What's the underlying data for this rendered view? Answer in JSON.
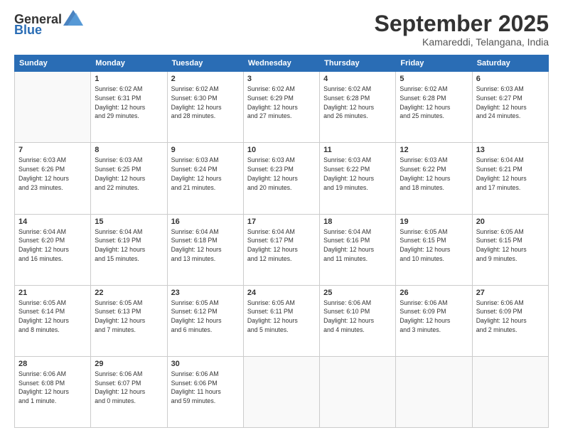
{
  "logo": {
    "general": "General",
    "blue": "Blue"
  },
  "header": {
    "month": "September 2025",
    "location": "Kamareddi, Telangana, India"
  },
  "weekdays": [
    "Sunday",
    "Monday",
    "Tuesday",
    "Wednesday",
    "Thursday",
    "Friday",
    "Saturday"
  ],
  "weeks": [
    [
      {
        "day": "",
        "info": ""
      },
      {
        "day": "1",
        "info": "Sunrise: 6:02 AM\nSunset: 6:31 PM\nDaylight: 12 hours\nand 29 minutes."
      },
      {
        "day": "2",
        "info": "Sunrise: 6:02 AM\nSunset: 6:30 PM\nDaylight: 12 hours\nand 28 minutes."
      },
      {
        "day": "3",
        "info": "Sunrise: 6:02 AM\nSunset: 6:29 PM\nDaylight: 12 hours\nand 27 minutes."
      },
      {
        "day": "4",
        "info": "Sunrise: 6:02 AM\nSunset: 6:28 PM\nDaylight: 12 hours\nand 26 minutes."
      },
      {
        "day": "5",
        "info": "Sunrise: 6:02 AM\nSunset: 6:28 PM\nDaylight: 12 hours\nand 25 minutes."
      },
      {
        "day": "6",
        "info": "Sunrise: 6:03 AM\nSunset: 6:27 PM\nDaylight: 12 hours\nand 24 minutes."
      }
    ],
    [
      {
        "day": "7",
        "info": "Sunrise: 6:03 AM\nSunset: 6:26 PM\nDaylight: 12 hours\nand 23 minutes."
      },
      {
        "day": "8",
        "info": "Sunrise: 6:03 AM\nSunset: 6:25 PM\nDaylight: 12 hours\nand 22 minutes."
      },
      {
        "day": "9",
        "info": "Sunrise: 6:03 AM\nSunset: 6:24 PM\nDaylight: 12 hours\nand 21 minutes."
      },
      {
        "day": "10",
        "info": "Sunrise: 6:03 AM\nSunset: 6:23 PM\nDaylight: 12 hours\nand 20 minutes."
      },
      {
        "day": "11",
        "info": "Sunrise: 6:03 AM\nSunset: 6:22 PM\nDaylight: 12 hours\nand 19 minutes."
      },
      {
        "day": "12",
        "info": "Sunrise: 6:03 AM\nSunset: 6:22 PM\nDaylight: 12 hours\nand 18 minutes."
      },
      {
        "day": "13",
        "info": "Sunrise: 6:04 AM\nSunset: 6:21 PM\nDaylight: 12 hours\nand 17 minutes."
      }
    ],
    [
      {
        "day": "14",
        "info": "Sunrise: 6:04 AM\nSunset: 6:20 PM\nDaylight: 12 hours\nand 16 minutes."
      },
      {
        "day": "15",
        "info": "Sunrise: 6:04 AM\nSunset: 6:19 PM\nDaylight: 12 hours\nand 15 minutes."
      },
      {
        "day": "16",
        "info": "Sunrise: 6:04 AM\nSunset: 6:18 PM\nDaylight: 12 hours\nand 13 minutes."
      },
      {
        "day": "17",
        "info": "Sunrise: 6:04 AM\nSunset: 6:17 PM\nDaylight: 12 hours\nand 12 minutes."
      },
      {
        "day": "18",
        "info": "Sunrise: 6:04 AM\nSunset: 6:16 PM\nDaylight: 12 hours\nand 11 minutes."
      },
      {
        "day": "19",
        "info": "Sunrise: 6:05 AM\nSunset: 6:15 PM\nDaylight: 12 hours\nand 10 minutes."
      },
      {
        "day": "20",
        "info": "Sunrise: 6:05 AM\nSunset: 6:15 PM\nDaylight: 12 hours\nand 9 minutes."
      }
    ],
    [
      {
        "day": "21",
        "info": "Sunrise: 6:05 AM\nSunset: 6:14 PM\nDaylight: 12 hours\nand 8 minutes."
      },
      {
        "day": "22",
        "info": "Sunrise: 6:05 AM\nSunset: 6:13 PM\nDaylight: 12 hours\nand 7 minutes."
      },
      {
        "day": "23",
        "info": "Sunrise: 6:05 AM\nSunset: 6:12 PM\nDaylight: 12 hours\nand 6 minutes."
      },
      {
        "day": "24",
        "info": "Sunrise: 6:05 AM\nSunset: 6:11 PM\nDaylight: 12 hours\nand 5 minutes."
      },
      {
        "day": "25",
        "info": "Sunrise: 6:06 AM\nSunset: 6:10 PM\nDaylight: 12 hours\nand 4 minutes."
      },
      {
        "day": "26",
        "info": "Sunrise: 6:06 AM\nSunset: 6:09 PM\nDaylight: 12 hours\nand 3 minutes."
      },
      {
        "day": "27",
        "info": "Sunrise: 6:06 AM\nSunset: 6:09 PM\nDaylight: 12 hours\nand 2 minutes."
      }
    ],
    [
      {
        "day": "28",
        "info": "Sunrise: 6:06 AM\nSunset: 6:08 PM\nDaylight: 12 hours\nand 1 minute."
      },
      {
        "day": "29",
        "info": "Sunrise: 6:06 AM\nSunset: 6:07 PM\nDaylight: 12 hours\nand 0 minutes."
      },
      {
        "day": "30",
        "info": "Sunrise: 6:06 AM\nSunset: 6:06 PM\nDaylight: 11 hours\nand 59 minutes."
      },
      {
        "day": "",
        "info": ""
      },
      {
        "day": "",
        "info": ""
      },
      {
        "day": "",
        "info": ""
      },
      {
        "day": "",
        "info": ""
      }
    ]
  ]
}
